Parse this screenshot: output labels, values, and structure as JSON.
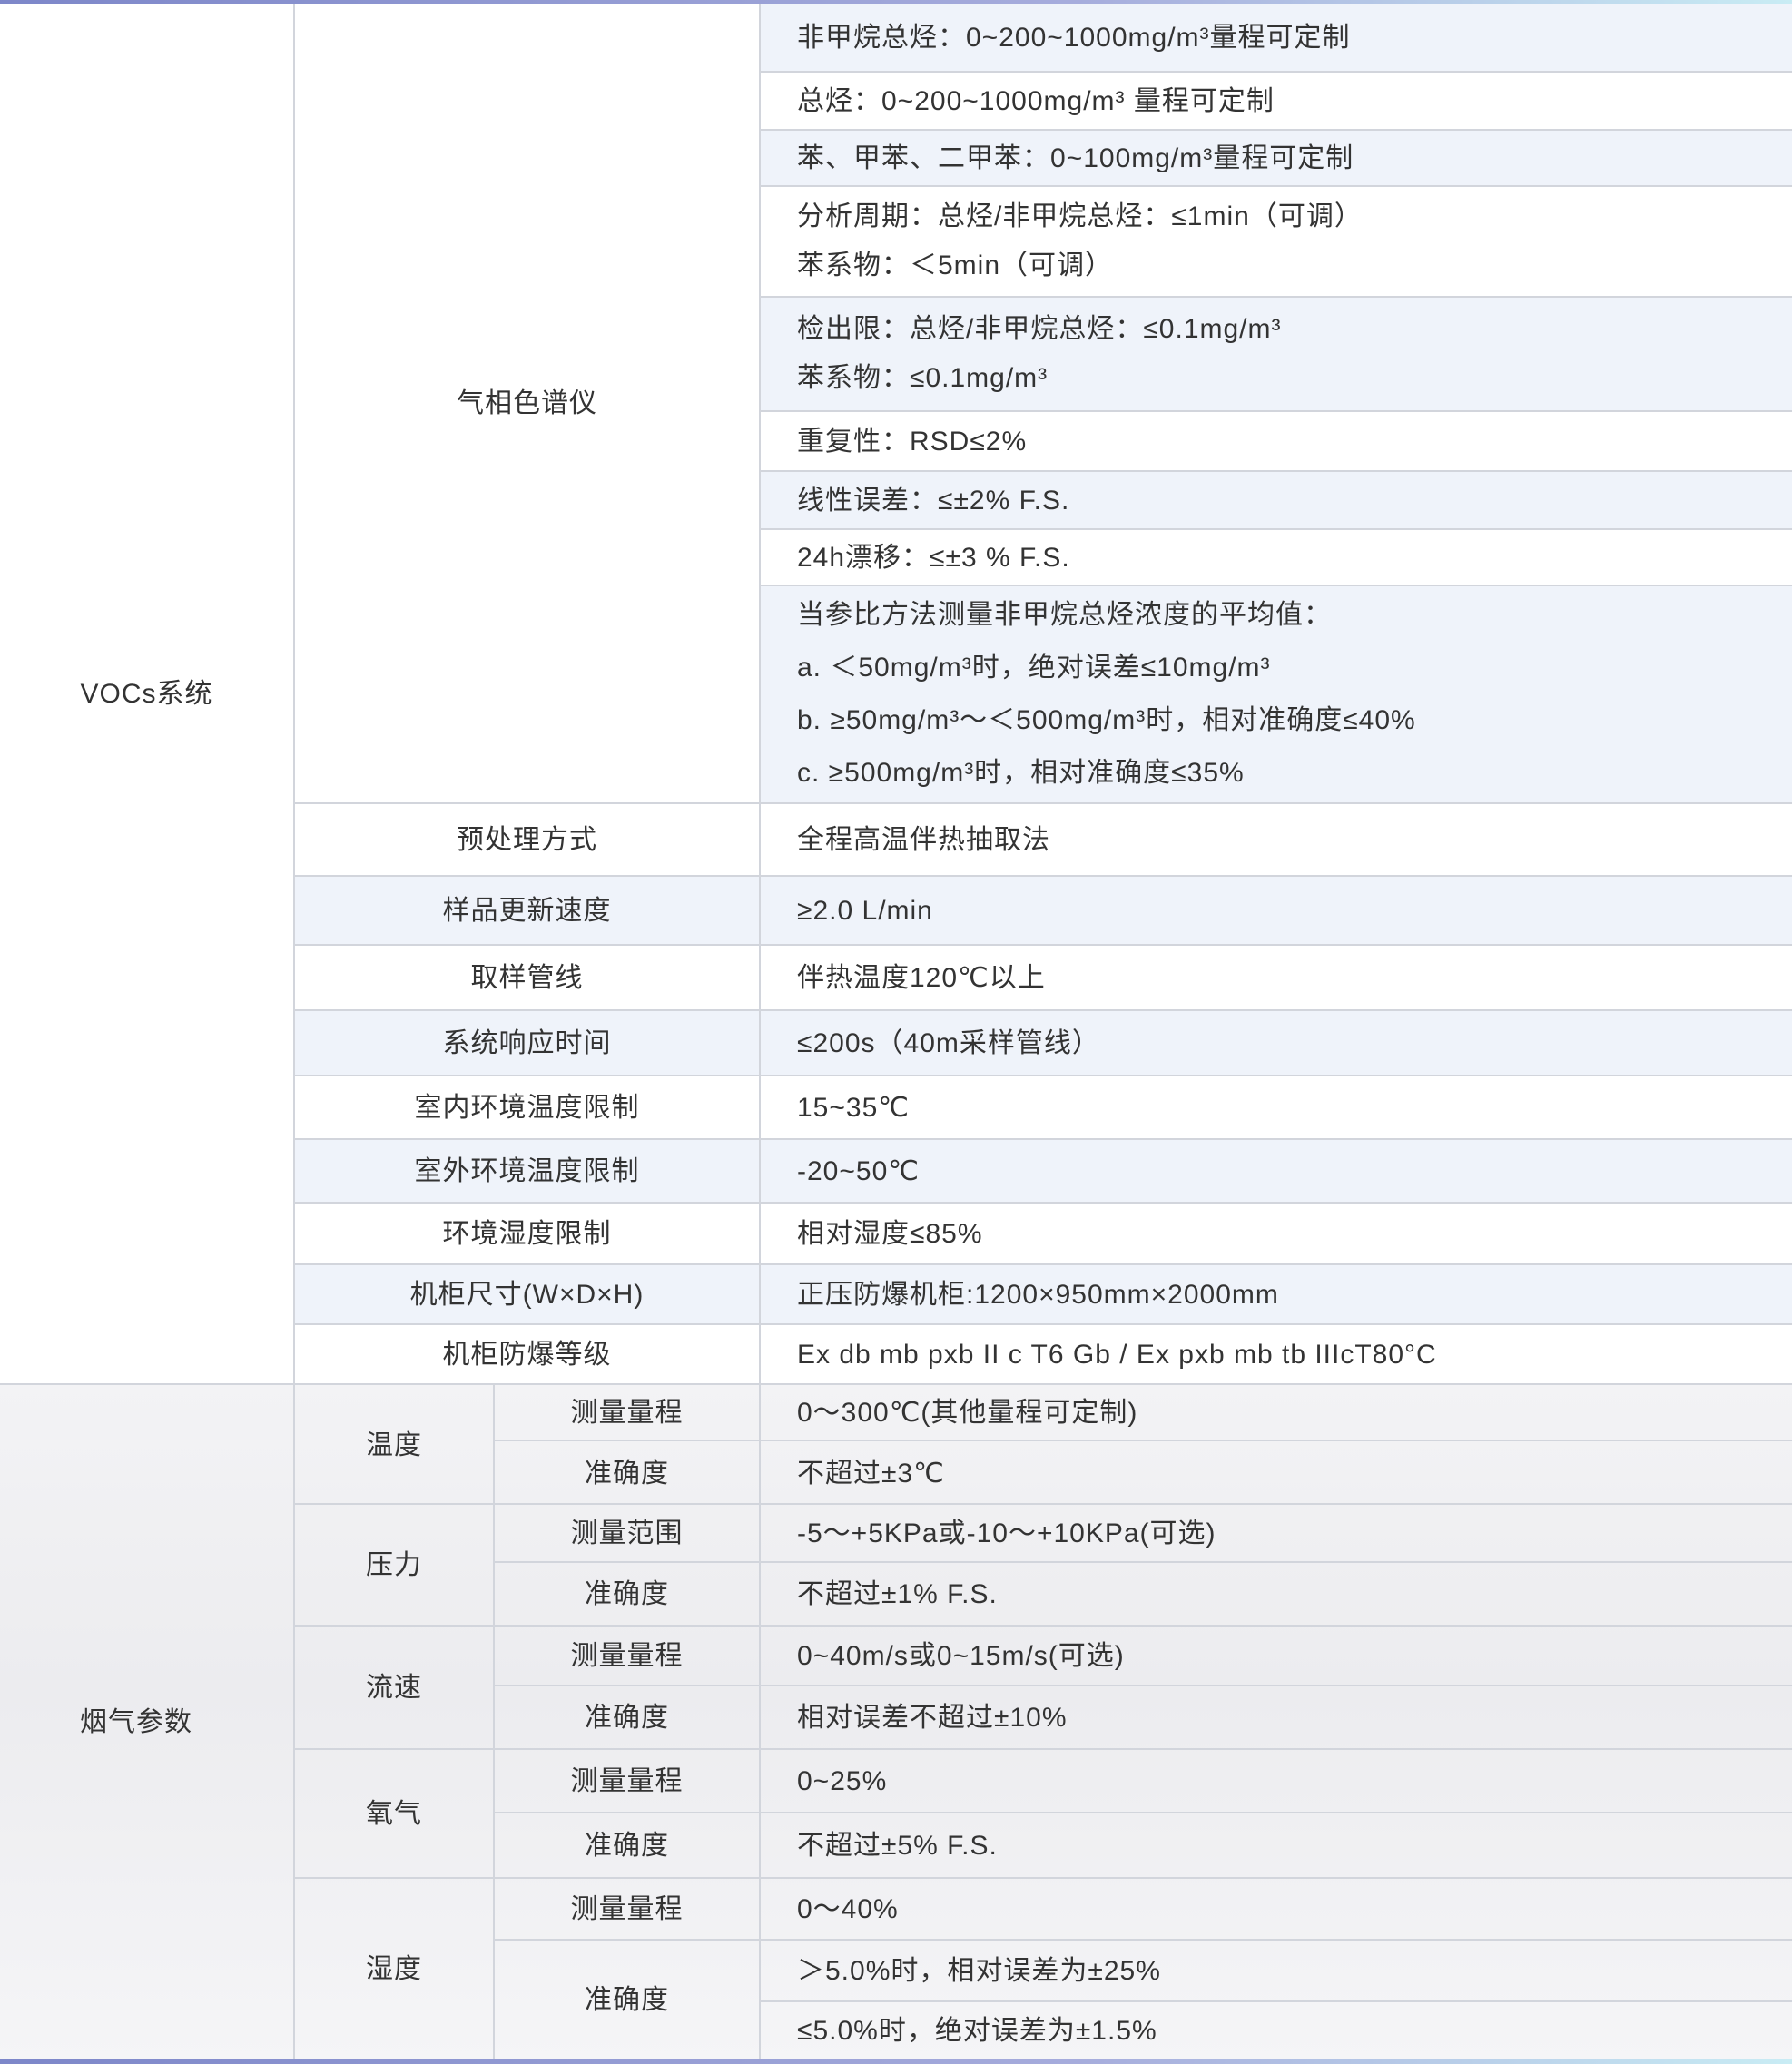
{
  "vocs": {
    "group_label": "VOCs系统",
    "gc_label": "气相色谱仪",
    "gc_specs": [
      "非甲烷总烃：0~200~1000mg/m³量程可定制",
      "总烃：0~200~1000mg/m³ 量程可定制",
      "苯、甲苯、二甲苯：0~100mg/m³量程可定制",
      [
        "分析周期：总烃/非甲烷总烃：≤1min（可调）",
        "苯系物：＜5min（可调）"
      ],
      [
        "检出限：总烃/非甲烷总烃：≤0.1mg/m³",
        "苯系物：≤0.1mg/m³"
      ],
      "重复性：RSD≤2%",
      "线性误差：≤±2% F.S.",
      "24h漂移：≤±3 % F.S.",
      [
        "当参比方法测量非甲烷总烃浓度的平均值：",
        "a. ＜50mg/m³时，绝对误差≤10mg/m³",
        "b. ≥50mg/m³～＜500mg/m³时，相对准确度≤40%",
        "c. ≥500mg/m³时，相对准确度≤35%"
      ]
    ],
    "rows": [
      {
        "label": "预处理方式",
        "value": "全程高温伴热抽取法"
      },
      {
        "label": "样品更新速度",
        "value": "≥2.0 L/min"
      },
      {
        "label": "取样管线",
        "value": "伴热温度120℃以上"
      },
      {
        "label": "系统响应时间",
        "value": "≤200s（40m采样管线）"
      },
      {
        "label": "室内环境温度限制",
        "value": "15~35℃"
      },
      {
        "label": "室外环境温度限制",
        "value": "-20~50℃"
      },
      {
        "label": "环境湿度限制",
        "value": "相对湿度≤85%"
      },
      {
        "label": "机柜尺寸(W×D×H)",
        "value": "正压防爆机柜:1200×950mm×2000mm"
      },
      {
        "label": "机柜防爆等级",
        "value": "Ex db mb pxb II c T6 Gb / Ex pxb mb tb IIIcT80°C"
      }
    ]
  },
  "flue": {
    "group_label": "烟气参数",
    "params": [
      {
        "name": "温度",
        "items": [
          {
            "label": "测量量程",
            "values": [
              "0～300℃(其他量程可定制)"
            ]
          },
          {
            "label": "准确度",
            "values": [
              "不超过±3℃"
            ]
          }
        ]
      },
      {
        "name": "压力",
        "items": [
          {
            "label": "测量范围",
            "values": [
              "-5～+5KPa或-10～+10KPa(可选)"
            ]
          },
          {
            "label": "准确度",
            "values": [
              "不超过±1% F.S."
            ]
          }
        ]
      },
      {
        "name": "流速",
        "items": [
          {
            "label": "测量量程",
            "values": [
              "0~40m/s或0~15m/s(可选)"
            ]
          },
          {
            "label": "准确度",
            "values": [
              "相对误差不超过±10%"
            ]
          }
        ]
      },
      {
        "name": "氧气",
        "items": [
          {
            "label": "测量量程",
            "values": [
              "0~25%"
            ]
          },
          {
            "label": "准确度",
            "values": [
              "不超过±5% F.S."
            ]
          }
        ]
      },
      {
        "name": "湿度",
        "items": [
          {
            "label": "测量量程",
            "values": [
              "0～40%"
            ]
          },
          {
            "label": "准确度",
            "values": [
              "＞5.0%时，相对误差为±25%",
              "≤5.0%时，绝对误差为±1.5%"
            ]
          }
        ]
      }
    ]
  }
}
